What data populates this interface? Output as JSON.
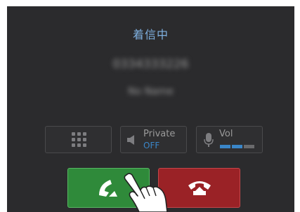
{
  "call": {
    "status_title": "着信中",
    "caller_number": "0334333226",
    "caller_name": "No Name"
  },
  "controls": {
    "keypad_icon": "keypad-icon",
    "private_label": "Private",
    "private_value": "OFF",
    "volume_label": "Vol",
    "volume_level": 0.67
  },
  "actions": {
    "answer_icon": "phone-answer-icon",
    "decline_icon": "phone-hangup-icon"
  },
  "colors": {
    "accent": "#3a86c8",
    "answer": "#2f8a3a",
    "decline": "#9a2226",
    "background": "#2b2b2d"
  }
}
